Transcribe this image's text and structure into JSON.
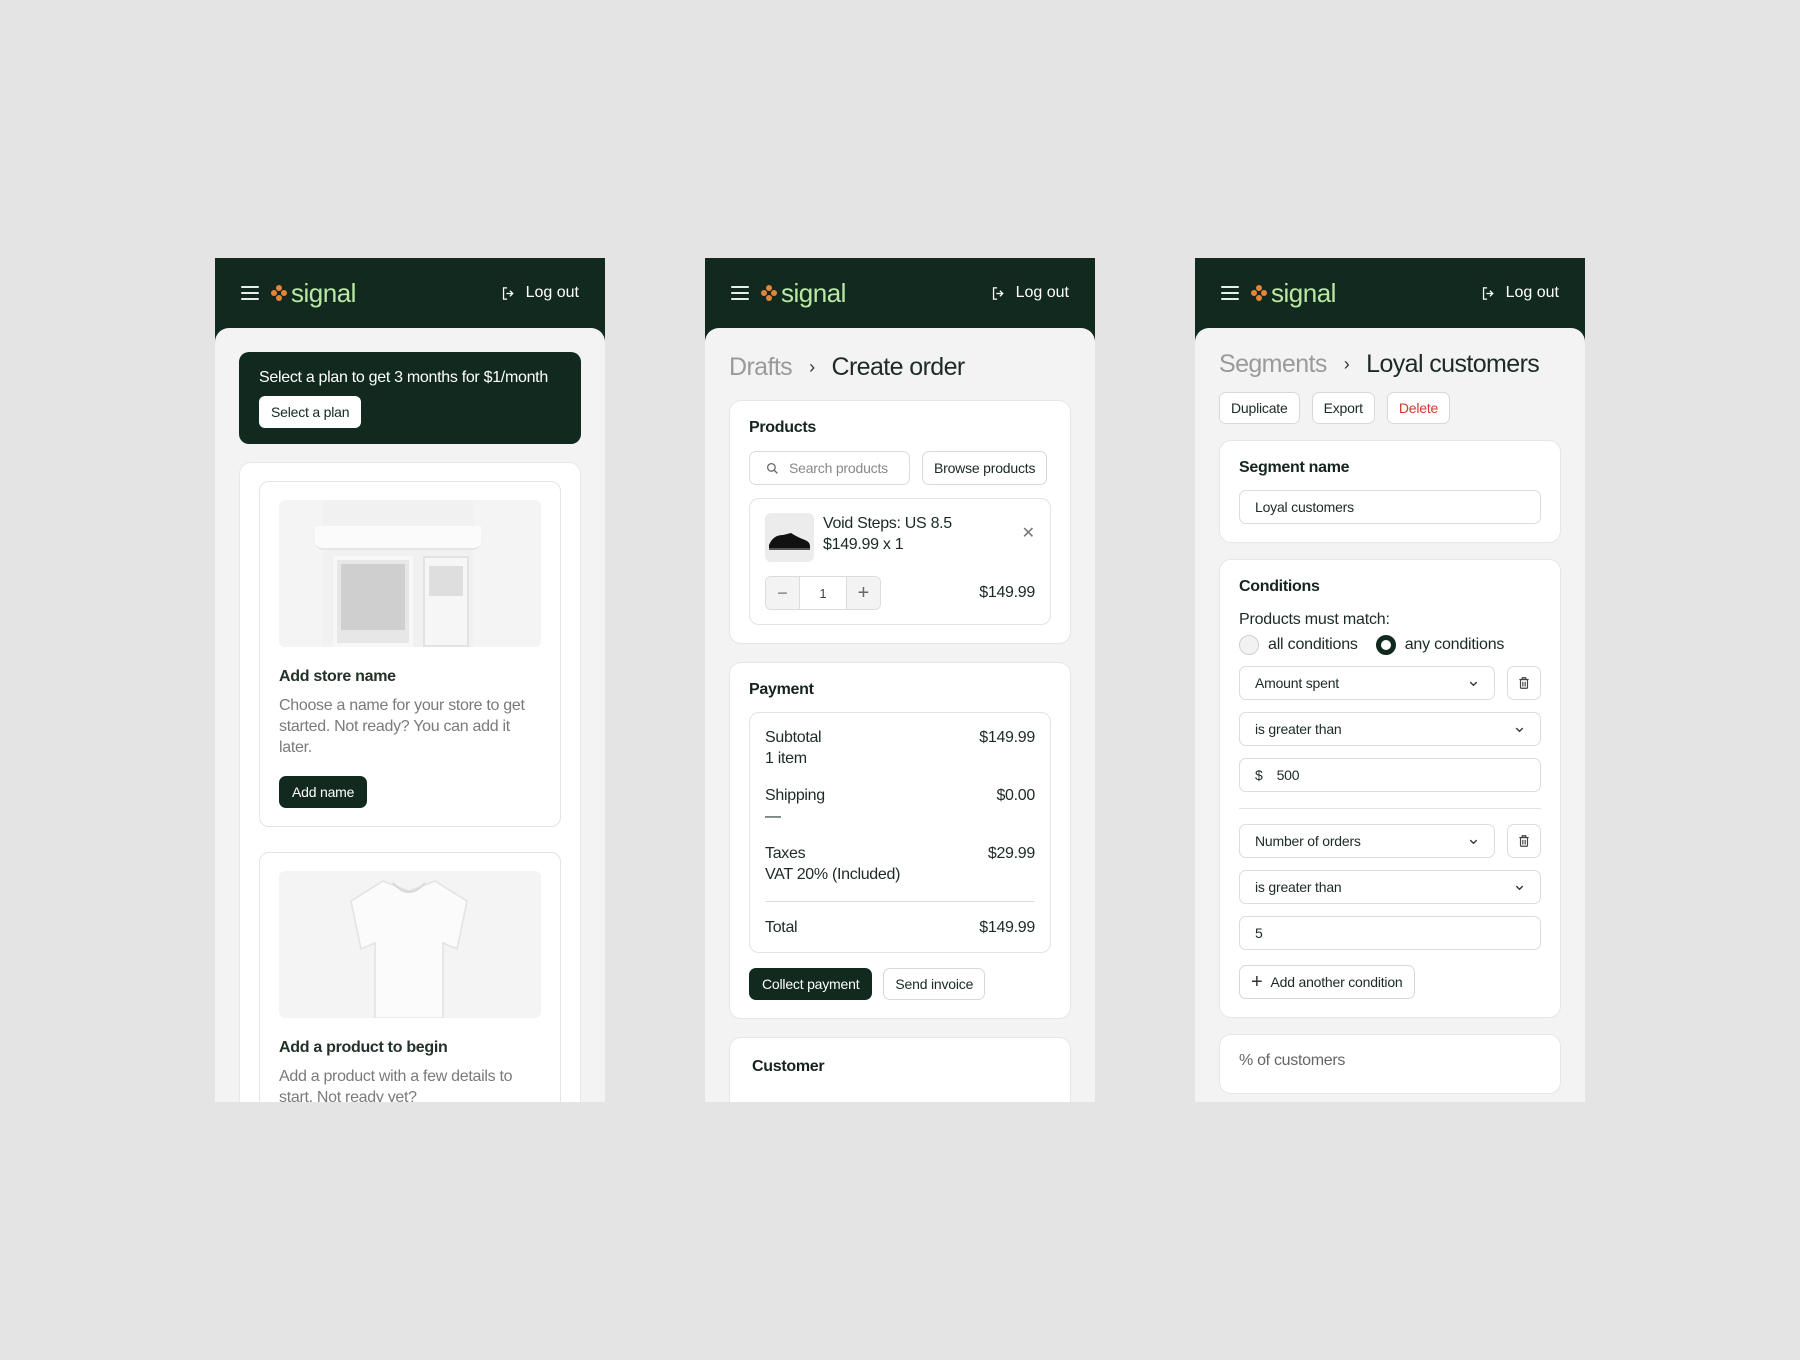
{
  "brand": {
    "name": "signal",
    "logout_label": "Log out",
    "colors": {
      "brand_dark": "#12291f",
      "logo_text": "#b9e8a2",
      "logo_mark": "#e8833a",
      "danger": "#d33a2c"
    }
  },
  "screen1": {
    "promo": {
      "text": "Select a plan to get 3 months for $1/month",
      "button": "Select a plan"
    },
    "cards": [
      {
        "title": "Add store name",
        "description": "Choose a name for your store to get started. Not ready? You can add it later.",
        "button": "Add name"
      },
      {
        "title": "Add a product to begin",
        "description": "Add a product with a few details to start. Not ready yet?"
      }
    ]
  },
  "screen2": {
    "breadcrumb": {
      "parent": "Drafts",
      "current": "Create order"
    },
    "products": {
      "title": "Products",
      "search_placeholder": "Search products",
      "browse_button": "Browse products",
      "item": {
        "name": "Void Steps: US 8.5",
        "price_qty": "$149.99 x 1",
        "quantity": "1",
        "line_total": "$149.99"
      }
    },
    "payment": {
      "title": "Payment",
      "rows": [
        {
          "label": "Subtotal",
          "sub": "1 item",
          "value": "$149.99"
        },
        {
          "label": "Shipping",
          "sub": "—",
          "value": "$0.00"
        },
        {
          "label": "Taxes",
          "sub": "VAT 20% (Included)",
          "value": "$29.99"
        }
      ],
      "total_label": "Total",
      "total_value": "$149.99",
      "collect_button": "Collect payment",
      "invoice_button": "Send invoice"
    },
    "customer": {
      "title": "Customer"
    }
  },
  "screen3": {
    "breadcrumb": {
      "parent": "Segments",
      "current": "Loyal customers"
    },
    "actions": {
      "duplicate": "Duplicate",
      "export": "Export",
      "delete": "Delete"
    },
    "segment_name": {
      "title": "Segment name",
      "value": "Loyal customers"
    },
    "conditions": {
      "title": "Conditions",
      "match_label": "Products must match:",
      "option_all": "all conditions",
      "option_any": "any conditions",
      "selected": "any conditions",
      "rules": [
        {
          "field": "Amount spent",
          "operator": "is greater than",
          "prefix": "$",
          "value": "500"
        },
        {
          "field": "Number of orders",
          "operator": "is greater than",
          "prefix": "",
          "value": "5"
        }
      ],
      "add_button": "Add another condition"
    },
    "next_section": {
      "title": "% of customers"
    }
  }
}
